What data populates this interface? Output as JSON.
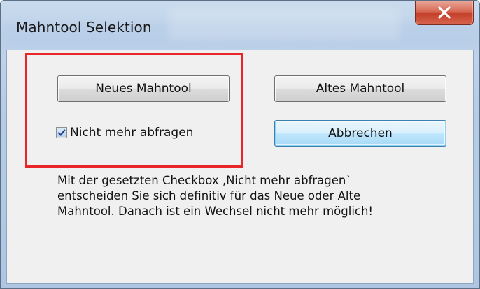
{
  "window": {
    "title": "Mahntool Selektion",
    "close_symbol": "X",
    "close_color": "#c4402a"
  },
  "buttons": {
    "new_label": "Neues Mahntool",
    "old_label": "Altes Mahntool",
    "cancel_label": "Abbrechen"
  },
  "checkbox": {
    "label": "Nicht mehr abfragen",
    "checked": true,
    "icon": "checkmark-icon"
  },
  "info": {
    "lines": [
      "Mit der gesetzten Checkbox ‚Nicht mehr abfragen`",
      "entscheiden Sie sich definitiv für das Neue oder Alte",
      "Mahntool. Danach ist ein Wechsel nicht mehr möglich!"
    ]
  },
  "highlight": {
    "color": "#e8262a"
  }
}
